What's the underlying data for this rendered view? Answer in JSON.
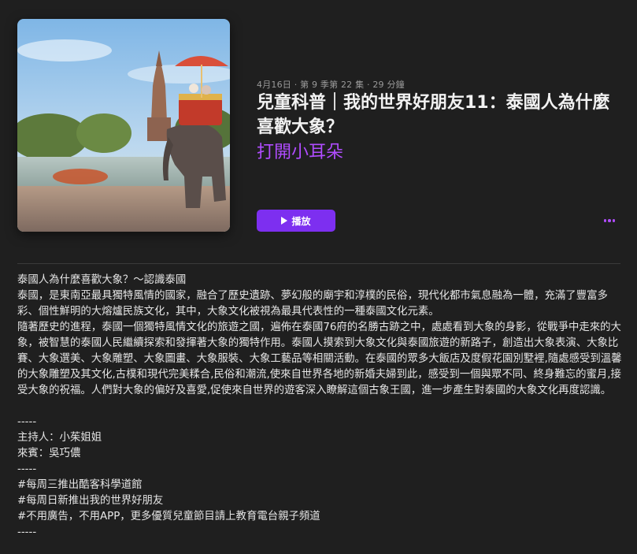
{
  "episode": {
    "meta": "4月16日 · 第 9 季第 22 集 · 29 分鐘",
    "title": "兒童科普｜我的世界好朋友11：泰國人為什麼喜歡大象？",
    "show_name": "打開小耳朵",
    "artwork_icon": "elephant-temple-artwork"
  },
  "actions": {
    "play_label": "播放",
    "play_icon": "play-icon",
    "more_icon": "more-icon"
  },
  "colors": {
    "accent": "#b04cff",
    "play_button": "#7d2ff0",
    "background": "#1f1f1f"
  },
  "description": {
    "lines": [
      "泰國人為什麼喜歡大象？～認識泰國",
      "泰國，是東南亞最具獨特風情的國家，融合了歷史遺跡、夢幻般的廟宇和淳樸的民俗，現代化都市氣息融為一體，充滿了豐富多彩、個性鮮明的大熔爐民族文化，其中，大象文化被視為最具代表性的一種泰國文化元素。",
      "隨著歷史的進程，泰國一個獨特風情文化的旅遊之國，遍佈在泰國76府的名勝古跡之中，處處看到大象的身影，從戰爭中走來的大象，被智慧的泰國人民繼續探索和發揮著大象的獨特作用。泰國人摸索到大象文化與泰國旅遊的新路子，創造出大象表演、大象比賽、大象選美、大象雕塑、大象圖畫、大象服裝、大象工藝品等相關活動。在泰國的眾多大飯店及度假花園別墅裡,隨處感受到溫馨的大象雕塑及其文化,古樸和現代完美糅合,民俗和潮流,使來自世界各地的新婚夫婦到此，感受到一個與眾不同、終身難忘的蜜月,接受大象的祝福。人們對大象的偏好及喜愛,促使來自世界的遊客深入瞭解這個古象王國，進一步產生對泰國的大象文化再度認識。",
      "",
      "-----",
      "主持人：小茱姐姐",
      "來賓：吳巧儂",
      "-----",
      "#每周三推出酷客科學道館",
      "#每周日新推出我的世界好朋友",
      "#不用廣告，不用APP，更多優質兒童節目請上教育電台親子頻道",
      "-----"
    ]
  }
}
